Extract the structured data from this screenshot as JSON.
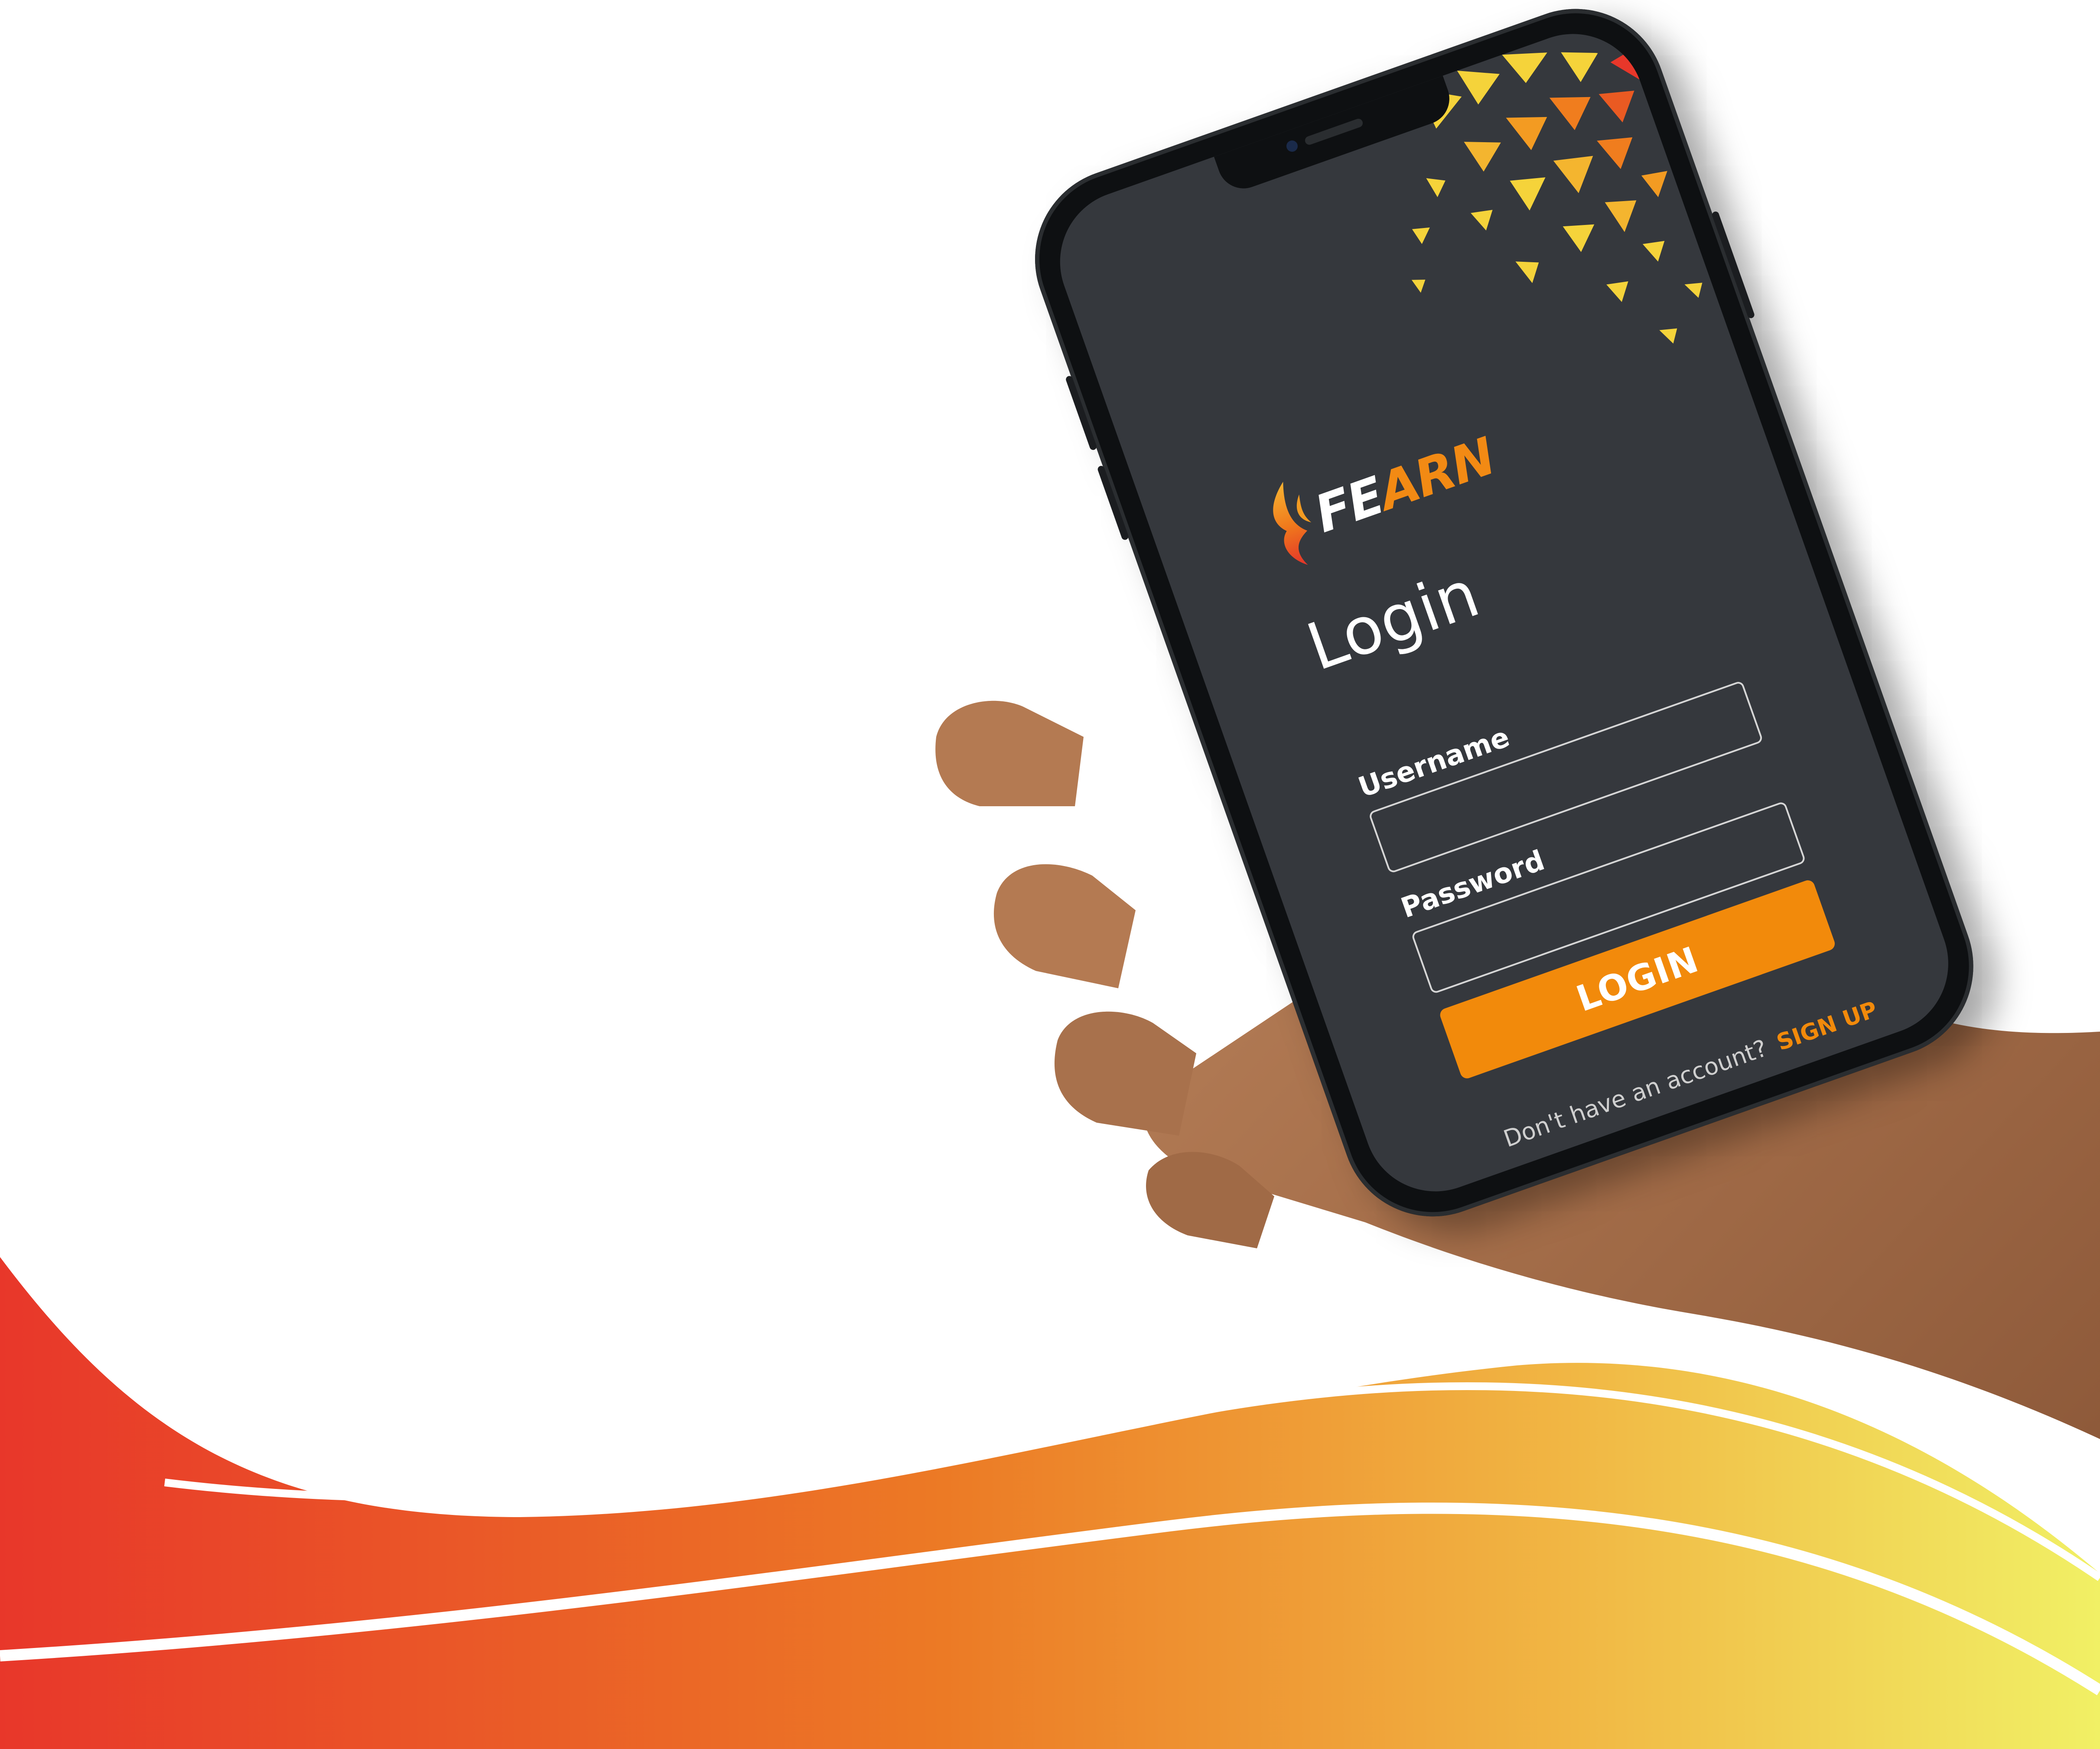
{
  "brand": {
    "logo_fe": "FE",
    "logo_arn": "ARN"
  },
  "login_screen": {
    "title": "Login",
    "username_label": "Username",
    "username_value": "",
    "password_label": "Password",
    "password_value": "",
    "login_button": "LOGIN",
    "no_account_text": "Don't have an account?",
    "signup_link": "SIGN UP"
  },
  "colors": {
    "screen_bg": "#35383d",
    "accent_orange": "#f28a0b",
    "triangle_yellow": "#f5d33a",
    "triangle_red": "#e8372a",
    "wave_red": "#e8372a",
    "wave_yellow": "#f1ef65"
  },
  "icons": {
    "logo": "flame-logo-icon",
    "decoration": "triangle-pattern"
  }
}
